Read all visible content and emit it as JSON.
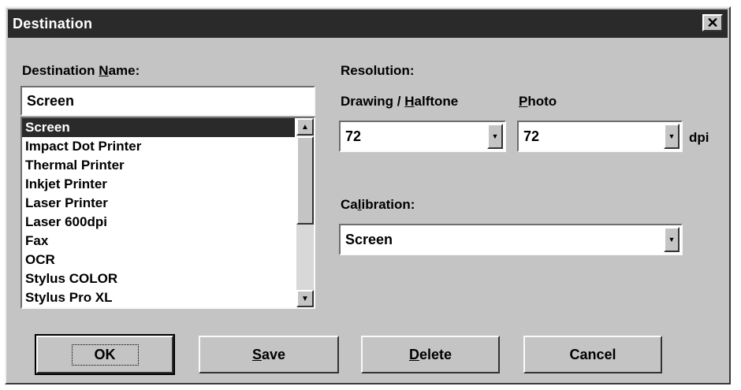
{
  "window": {
    "title": "Destination",
    "close_glyph": "✕"
  },
  "destination_name": {
    "label_pre": "Destination ",
    "label_u": "N",
    "label_post": "ame:",
    "value": "Screen"
  },
  "destination_list": {
    "items": [
      "Screen",
      "Impact Dot Printer",
      "Thermal Printer",
      "Inkjet Printer",
      "Laser Printer",
      "Laser 600dpi",
      "Fax",
      "OCR",
      "Stylus COLOR",
      "Stylus Pro XL"
    ],
    "selected_index": 0
  },
  "resolution": {
    "label": "Resolution:",
    "drawing_label_pre": "Drawing / ",
    "drawing_label_u": "H",
    "drawing_label_post": "alftone",
    "drawing_value": "72",
    "photo_label_u": "P",
    "photo_label_post": "hoto",
    "photo_value": "72",
    "unit": "dpi"
  },
  "calibration": {
    "label_pre": "Ca",
    "label_u": "l",
    "label_post": "ibration:",
    "value": "Screen"
  },
  "buttons": {
    "ok": "OK",
    "save_u": "S",
    "save_post": "ave",
    "delete_u": "D",
    "delete_post": "elete",
    "cancel": "Cancel"
  },
  "icons": {
    "close": "close-icon",
    "scroll_up": "arrow-up-icon",
    "scroll_down": "arrow-down-icon",
    "dropdown": "chevron-down-icon"
  }
}
